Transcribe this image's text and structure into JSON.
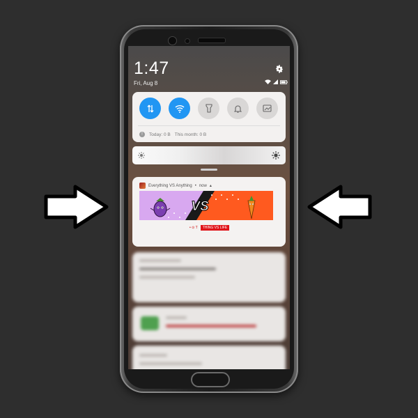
{
  "status_bar": {
    "time": "1:47",
    "date": "Fri, Aug 8"
  },
  "quick_settings": {
    "toggles": [
      {
        "name": "mobile-data",
        "state": "on"
      },
      {
        "name": "wifi",
        "state": "on"
      },
      {
        "name": "flashlight",
        "state": "off"
      },
      {
        "name": "sound",
        "state": "off"
      },
      {
        "name": "screenshot",
        "state": "off"
      }
    ],
    "data_today": "Today: 0 B",
    "data_month": "This month: 0 B"
  },
  "notification": {
    "app_name": "Everything VS Anything",
    "time": "now",
    "vs_text": "VS",
    "sub_left": "• ⊙ T",
    "sub_chip": "THING VS LIFE"
  },
  "colors": {
    "accent": "#2196f3",
    "vs_left_bg": "#d8a8f0",
    "vs_right_bg": "#ff5a1f",
    "vs_band": "#1a1a1a"
  },
  "icons": [
    "gear-icon",
    "wifi-icon",
    "signal-icon",
    "battery-icon",
    "data-arrows-icon",
    "flashlight-icon",
    "bell-icon",
    "screenshot-icon",
    "info-icon",
    "sun-icon"
  ]
}
